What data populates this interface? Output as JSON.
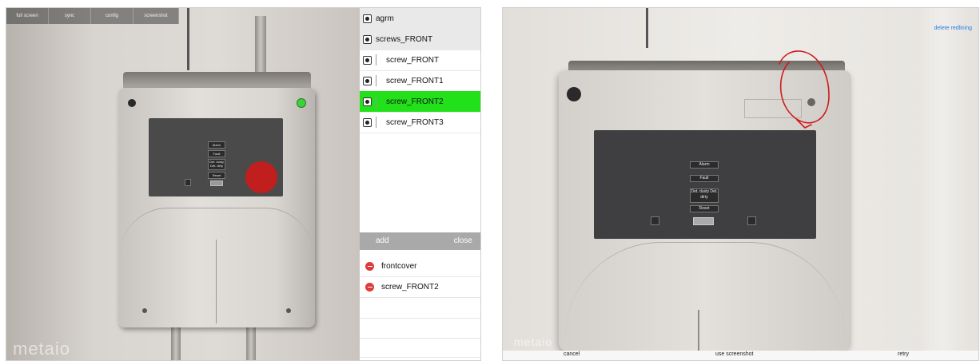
{
  "left_panel": {
    "toolbar": {
      "items": [
        "full screen",
        "sync",
        "config",
        "screenshot"
      ]
    },
    "watermark": "metaio",
    "device_labels": [
      "Alarm",
      "Fault",
      "Det. dusty Det. dirty",
      "Reset"
    ],
    "tree": {
      "items": [
        {
          "label": "agrm",
          "kind": "group"
        },
        {
          "label": "screws_FRONT",
          "kind": "group"
        },
        {
          "label": "screw_FRONT",
          "kind": "child"
        },
        {
          "label": "screw_FRONT1",
          "kind": "child"
        },
        {
          "label": "screw_FRONT2",
          "kind": "child",
          "selected": true
        },
        {
          "label": "screw_FRONT3",
          "kind": "child"
        }
      ],
      "selected_color": "#22e11a"
    },
    "action_bar": {
      "add": "add",
      "close": "close"
    },
    "object_list": {
      "items": [
        {
          "label": "frontcover"
        },
        {
          "label": "screw_FRONT2"
        }
      ]
    }
  },
  "right_panel": {
    "delete_redlining": "delete redlining",
    "device_labels": [
      "Alarm",
      "Fault",
      "Det. dusty Det. dirty",
      "Reset"
    ],
    "watermark": "metaio",
    "bottom_bar": {
      "cancel": "cancel",
      "use_screenshot": "use screenshot",
      "retry": "retry"
    },
    "redline_color": "#d11a1a",
    "link_color": "#2a7ee0"
  }
}
